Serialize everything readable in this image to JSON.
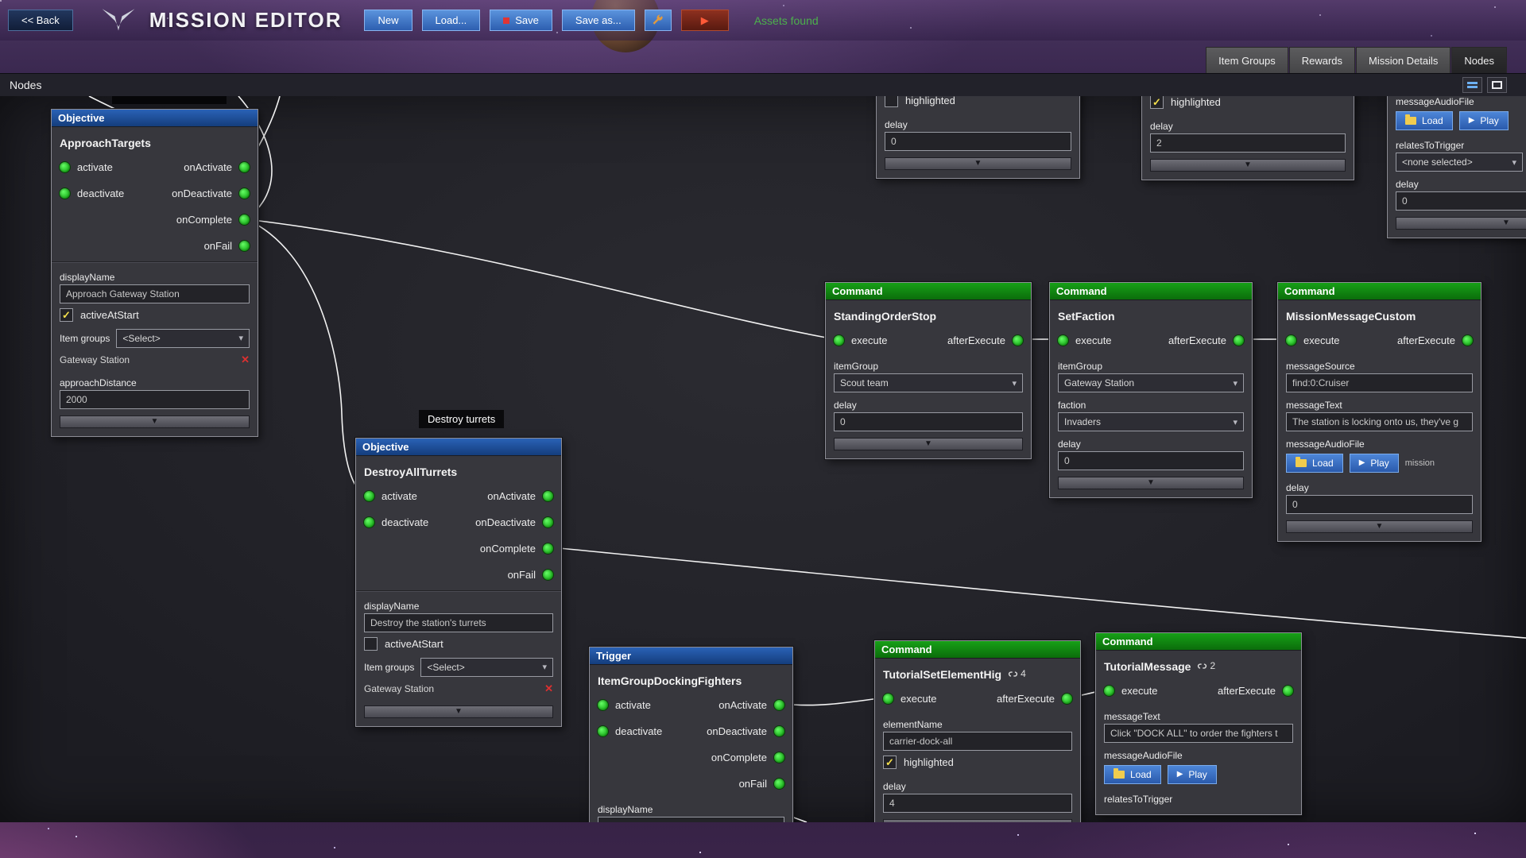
{
  "toolbar": {
    "back": "<< Back",
    "title": "MISSION EDITOR",
    "new": "New",
    "load": "Load...",
    "save": "Save",
    "save_as": "Save as...",
    "assets": "Assets found"
  },
  "tabs": {
    "item_groups": "Item Groups",
    "rewards": "Rewards",
    "mission_details": "Mission Details",
    "nodes": "Nodes"
  },
  "panel": {
    "title": "Nodes"
  },
  "labels": {
    "objective": "Objective",
    "command": "Command",
    "trigger": "Trigger",
    "activate": "activate",
    "deactivate": "deactivate",
    "on_activate": "onActivate",
    "on_deactivate": "onDeactivate",
    "on_complete": "onComplete",
    "on_fail": "onFail",
    "execute": "execute",
    "after_execute": "afterExecute",
    "display_name": "displayName",
    "active_at_start": "activeAtStart",
    "item_groups": "Item groups",
    "select": "<Select>",
    "item_group": "itemGroup",
    "faction": "faction",
    "delay": "delay",
    "highlighted": "highlighted",
    "message_source": "messageSource",
    "message_text": "messageText",
    "message_audio_file": "messageAudioFile",
    "relates_to_trigger": "relatesToTrigger",
    "element_name": "elementName",
    "approach_distance": "approachDistance",
    "load": "Load",
    "play": "Play",
    "mission": "mission",
    "none_selected": "<none selected>",
    "check": "✓"
  },
  "nodes": {
    "approach_targets": {
      "title": "ApproachTargets",
      "display_name": "Approach Gateway Station",
      "group": "Gateway Station",
      "approach_distance": "2000"
    },
    "destroy_turrets": {
      "tooltip": "Destroy turrets",
      "title": "DestroyAllTurrets",
      "display_name": "Destroy the station's turrets",
      "group": "Gateway Station"
    },
    "standing_order_stop": {
      "title": "StandingOrderStop",
      "item_group": "Scout team",
      "delay": "0"
    },
    "set_faction": {
      "title": "SetFaction",
      "item_group": "Gateway Station",
      "faction": "Invaders",
      "delay": "0"
    },
    "mission_message_custom": {
      "title": "MissionMessageCustom",
      "message_source": "find:0:Cruiser",
      "message_text": "The station is locking onto us, they've g",
      "delay": "0"
    },
    "docking_fighters": {
      "title": "ItemGroupDockingFighters"
    },
    "tutorial_set_element": {
      "title": "TutorialSetElementHig",
      "badge": "4",
      "element_name": "carrier-dock-all",
      "delay": "4"
    },
    "tutorial_message": {
      "title": "TutorialMessage",
      "badge": "2",
      "message_text": "Click \"DOCK ALL\" to order the fighters t"
    },
    "fragment_a": {
      "delay": "0"
    },
    "fragment_b": {
      "delay": "2"
    },
    "fragment_c": {
      "delay": "0"
    }
  }
}
